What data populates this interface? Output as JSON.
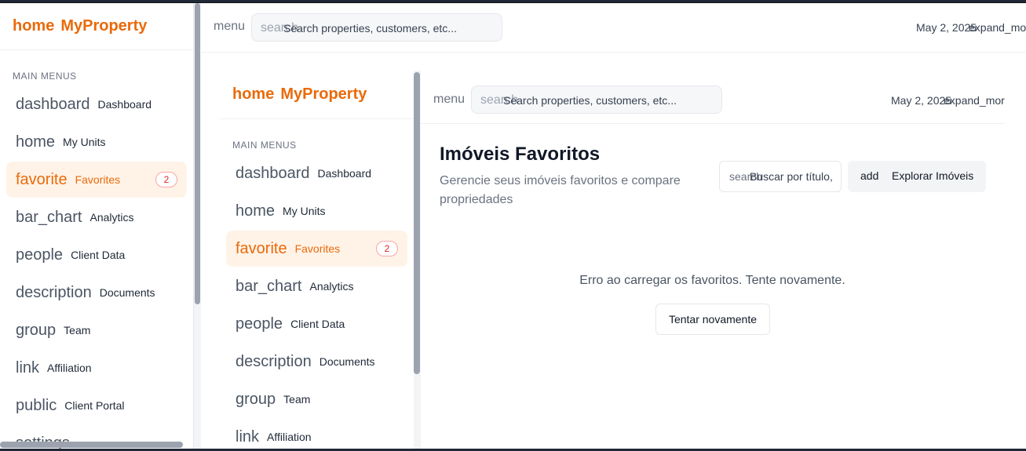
{
  "brand": {
    "icon": "home",
    "name": "MyProperty"
  },
  "sidebar": {
    "section_title": "MAIN MENUS",
    "items": [
      {
        "icon": "dashboard",
        "label": "Dashboard"
      },
      {
        "icon": "home",
        "label": "My Units"
      },
      {
        "icon": "favorite",
        "label": "Favorites",
        "badge": "2",
        "active": true
      },
      {
        "icon": "bar_chart",
        "label": "Analytics"
      },
      {
        "icon": "people",
        "label": "Client Data"
      },
      {
        "icon": "description",
        "label": "Documents"
      },
      {
        "icon": "group",
        "label": "Team"
      },
      {
        "icon": "link",
        "label": "Affiliation"
      },
      {
        "icon": "public",
        "label": "Client Portal"
      },
      {
        "icon": "settings",
        "label": ""
      }
    ]
  },
  "topbar": {
    "menu": "menu",
    "search_icon": "search",
    "search_placeholder": "Search properties, customers, etc...",
    "date": "May 2, 2025",
    "expand": "expand_more"
  },
  "main": {
    "title": "Imóveis Favoritos",
    "subtitle": "Gerencie seus imóveis favoritos e compare propriedades",
    "search_icon": "search",
    "search_placeholder": "Buscar por título,",
    "explore_icon": "add",
    "explore_label": "Explorar Imóveis",
    "error": "Erro ao carregar os favoritos. Tente novamente.",
    "retry": "Tentar novamente"
  },
  "colors": {
    "brand": "#ea6a0a",
    "active_bg": "#fff3e8",
    "badge": "#dc2626"
  }
}
